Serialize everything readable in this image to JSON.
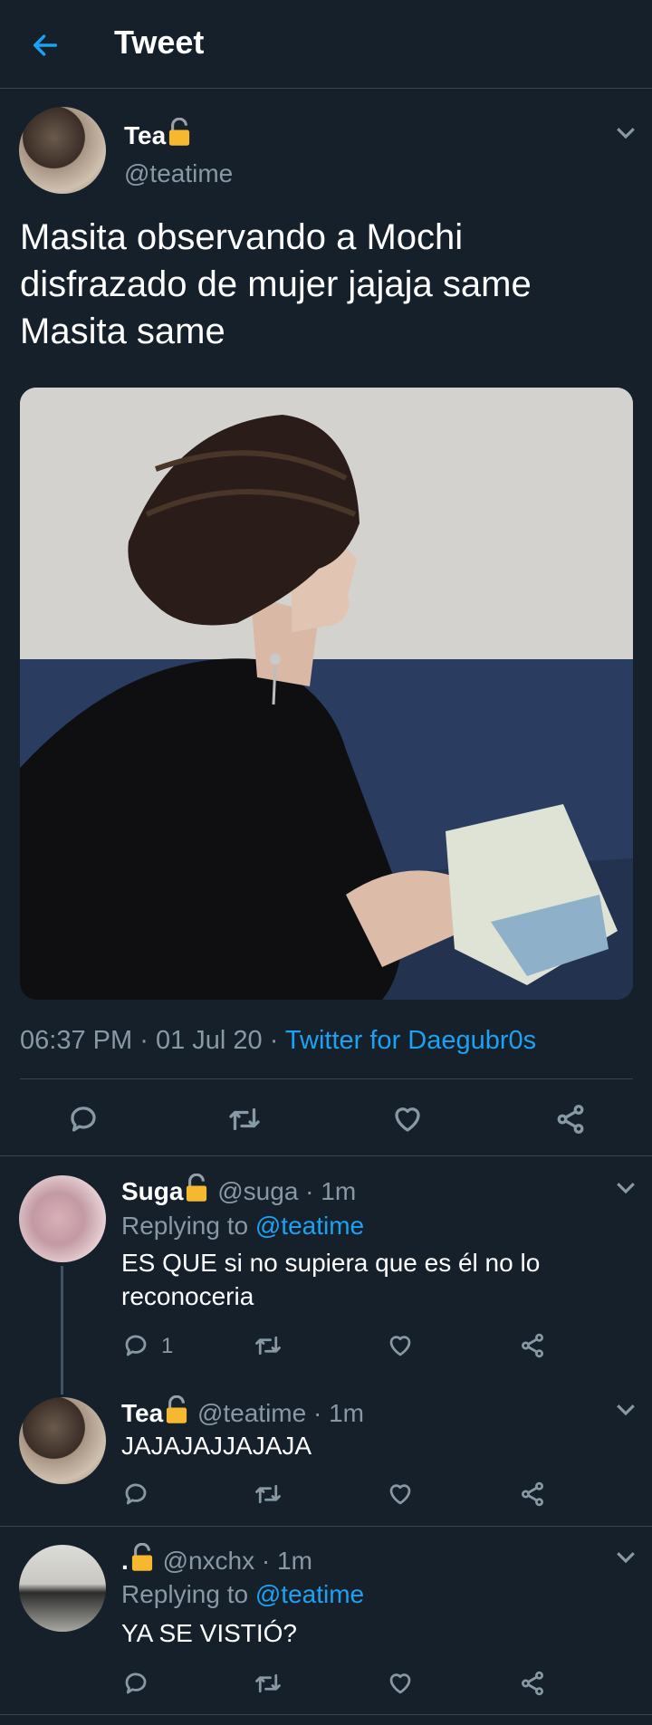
{
  "header": {
    "title": "Tweet",
    "back_icon": "arrow-left-icon"
  },
  "main_tweet": {
    "name": "Tea",
    "handle": "@teatime",
    "text": "Masita observando a Mochi disfrazado de mujer jajaja same Masita same",
    "time": "06:37 PM",
    "date": "01 Jul 20",
    "separator": "·",
    "client": "Twitter for Daegubr0s"
  },
  "replies": [
    {
      "name": "Suga",
      "handle": "@suga",
      "age": "1m",
      "replying_label": "Replying to",
      "replying_to": "@teatime",
      "text": "ES QUE si no supiera que es él no lo reconoceria",
      "reply_count": "1"
    },
    {
      "name": "Tea",
      "handle": "@teatime",
      "age": "1m",
      "text": "JAJAJAJJAJAJA"
    },
    {
      "name": ".",
      "handle": "@nxchx",
      "age": "1m",
      "replying_label": "Replying to",
      "replying_to": "@teatime",
      "text": "YA SE VISTIÓ?"
    }
  ],
  "colors": {
    "background": "#15202b",
    "accent": "#1da1f2",
    "muted": "#8899a6",
    "divider": "#38444d",
    "lock": "#f5b82e"
  },
  "icons": [
    "arrow-left-icon",
    "lock-icon",
    "chevron-down-icon",
    "reply-icon",
    "retweet-icon",
    "like-icon",
    "share-icon"
  ]
}
